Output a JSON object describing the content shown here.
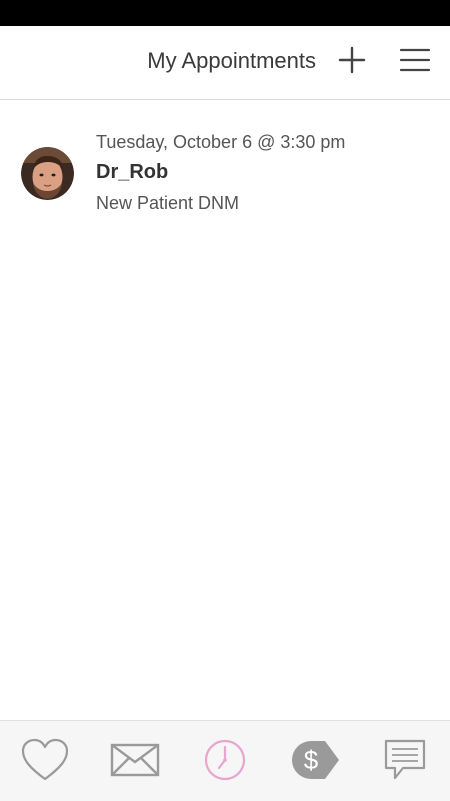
{
  "header": {
    "title": "My Appointments",
    "add_icon": "plus-icon",
    "menu_icon": "hamburger-menu-icon"
  },
  "appointments": [
    {
      "datetime": "Tuesday, October 6 @ 3:30 pm",
      "doctor": "Dr_Rob",
      "type": "New Patient DNM",
      "avatar_icon": "doctor-avatar"
    }
  ],
  "bottom_nav": {
    "items": [
      {
        "icon": "heart-icon",
        "active": false
      },
      {
        "icon": "mail-icon",
        "active": false
      },
      {
        "icon": "clock-icon",
        "active": true
      },
      {
        "icon": "dollar-tag-icon",
        "active": false
      },
      {
        "icon": "chat-icon",
        "active": false
      }
    ]
  },
  "colors": {
    "status_bar": "#000000",
    "text_primary": "#333333",
    "text_secondary": "#555555",
    "icon_gray": "#9a9a9a",
    "active_pink": "#e7a6cf",
    "nav_background": "#f6f6f6"
  }
}
